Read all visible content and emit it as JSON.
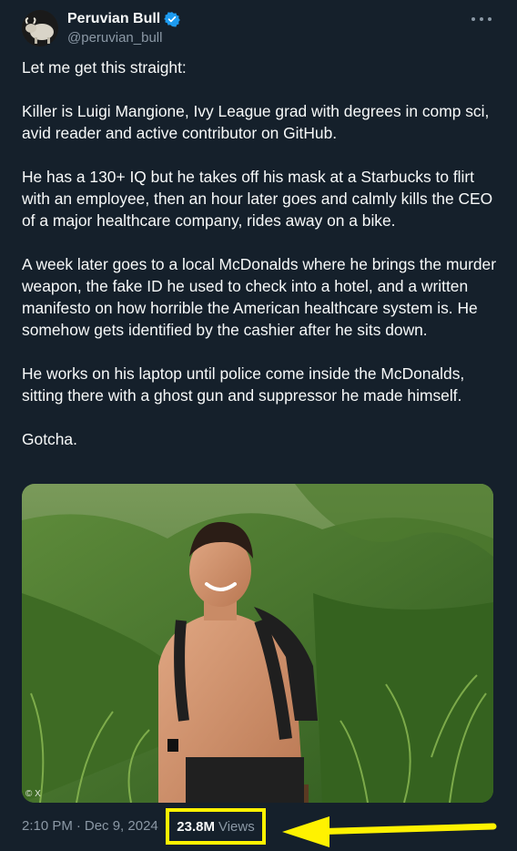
{
  "author": {
    "display_name": "Peruvian Bull",
    "handle": "@peruvian_bull",
    "verified": true,
    "verified_color": "#1d9bf0"
  },
  "tweet": {
    "paragraphs": [
      "Let me get this straight:",
      "Killer is Luigi Mangione, Ivy League grad with degrees in comp sci, avid reader and active contributor on GitHub.",
      "He has a 130+ IQ but he takes off his mask at a Starbucks to flirt with an employee, then an hour later goes and calmly kills the CEO of a major healthcare company, rides away on a bike.",
      "A week later goes to a local McDonalds where he brings the murder weapon, the fake ID he used to check into a hotel, and a written manifesto on how horrible the American healthcare system is. He somehow gets identified by the cashier after he sits down.",
      "He works on his laptop until police come inside the McDonalds, sitting there with a ghost gun and suppressor he made himself.",
      "Gotcha."
    ]
  },
  "media": {
    "watermark": "© X"
  },
  "meta": {
    "time": "2:10 PM",
    "separator": "·",
    "date": "Dec 9, 2024",
    "views_count": "23.8M",
    "views_label": "Views"
  },
  "annotation": {
    "highlight_color": "#fff200"
  },
  "icons": {
    "verified": "verified-badge-icon",
    "more": "more-options-icon",
    "arrow": "arrow-left-icon"
  }
}
